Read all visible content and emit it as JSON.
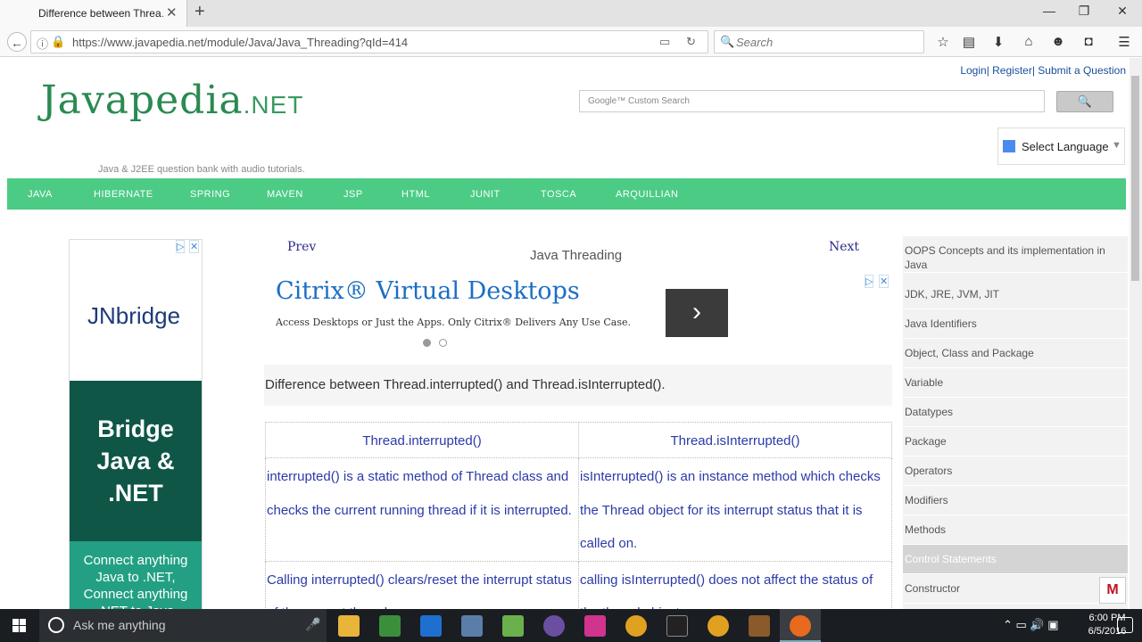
{
  "browser": {
    "tab_title": "Difference between Threa…",
    "tab_close": "✕",
    "new_tab": "+",
    "url": "https://www.javapedia.net/module/Java/Java_Threading?qId=414",
    "search_placeholder": "Search"
  },
  "site": {
    "top_links": "Login| Register| Submit a Question",
    "logo_main": "Javapedia",
    "logo_suffix": ".NET",
    "tagline": "Java & J2EE question bank with audio tutorials.",
    "google_search_placeholder": "Google™ Custom Search",
    "google_search_button": "🔍",
    "select_language": "Select Language",
    "nav": [
      "JAVA",
      "HIBERNATE",
      "SPRING",
      "MAVEN",
      "JSP",
      "HTML",
      "JUNIT",
      "TOSCA",
      "ARQUILLIAN"
    ]
  },
  "left_ad": {
    "brand": "JNbridge",
    "headline": "Bridge Java & .NET",
    "body": "Connect anything Java to .NET, Connect anything .NET to Java"
  },
  "article": {
    "prev": "Prev",
    "next": "Next",
    "title": "Java Threading",
    "ad_title": "Citrix® Virtual Desktops",
    "ad_desc": "Access Desktops or Just the Apps. Only Citrix® Delivers Any Use Case.",
    "question": "Difference between Thread.interrupted() and Thread.isInterrupted().",
    "table_headers": [
      "Thread.interrupted()",
      "Thread.isInterrupted()"
    ],
    "table_rows": [
      [
        "interrupted() is a static method of Thread class and checks the current running thread if it is interrupted.",
        "isInterrupted() is an instance method which checks the Thread object for its interrupt status that it is called on."
      ],
      [
        "Calling interrupted() clears/reset the interrupt status of the current thread.",
        "calling isInterrupted() does not affect the status of the thread object."
      ]
    ]
  },
  "sidebar": {
    "items": [
      "OOPS Concepts and its implementation in Java",
      "JDK, JRE, JVM, JIT",
      "Java Identifiers",
      "Object, Class and Package",
      "Variable",
      "Datatypes",
      "Package",
      "Operators",
      "Modifiers",
      "Methods",
      "Control Statements",
      "Constructor"
    ],
    "active_index": 10
  },
  "taskbar": {
    "cortana_text": "Ask me anything",
    "time": "6:00 PM",
    "date": "6/5/2016"
  },
  "colors": {
    "menu_green": "#4ccb85",
    "logo_green": "#2a8a52",
    "ad_dark_green": "#0f5647",
    "link_blue": "#2b3aa8"
  }
}
